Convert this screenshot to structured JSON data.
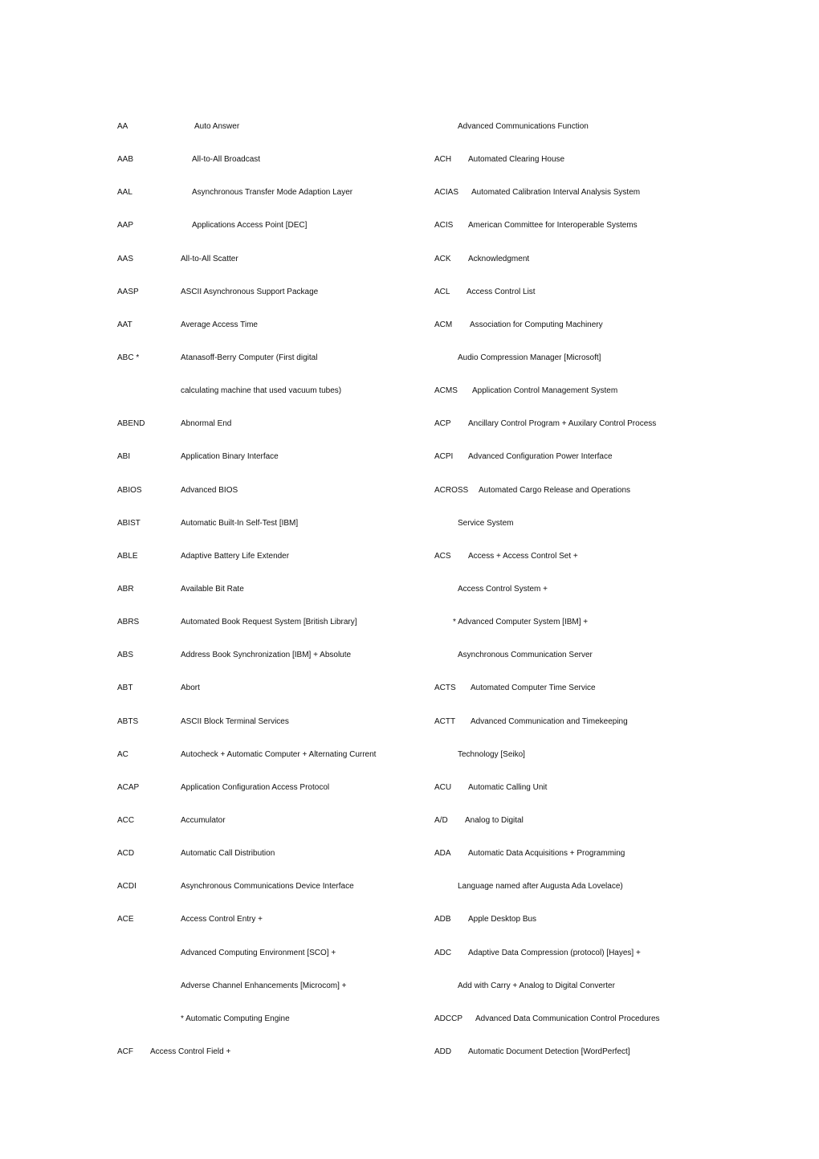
{
  "left_column": [
    {
      "abbr": "AA",
      "def": "Auto Answer"
    },
    {
      "abbr": "AAB",
      "def": "All-to-All Broadcast"
    },
    {
      "abbr": "AAL",
      "def": "Asynchronous Transfer Mode Adaption Layer"
    },
    {
      "abbr": "AAP",
      "def": "Applications Access Point [DEC]"
    },
    {
      "abbr": "AAS",
      "def": "All-to-All Scatter"
    },
    {
      "abbr": "AASP",
      "def": "ASCII Asynchronous Support Package"
    },
    {
      "abbr": "AAT",
      "def": "Average Access Time"
    },
    {
      "abbr": "ABC    *",
      "def": "Atanasoff-Berry Computer  (First digital"
    },
    {
      "abbr": "",
      "def": "calculating machine that used vacuum tubes)"
    },
    {
      "abbr": "ABEND",
      "def": "Abnormal End"
    },
    {
      "abbr": "ABI",
      "def": "Application Binary Interface"
    },
    {
      "abbr": "ABIOS",
      "def": "Advanced BIOS"
    },
    {
      "abbr": "ABIST",
      "def": "Automatic Built-In Self-Test [IBM]"
    },
    {
      "abbr": "ABLE",
      "def": "Adaptive Battery Life Extender"
    },
    {
      "abbr": "ABR",
      "def": "Available Bit Rate"
    },
    {
      "abbr": "ABRS",
      "def": "Automated Book Request System [British Library]"
    },
    {
      "abbr": "ABS",
      "def": "Address Book Synchronization [IBM] + Absolute"
    },
    {
      "abbr": "ABT",
      "def": "Abort"
    },
    {
      "abbr": "ABTS",
      "def": "ASCII Block Terminal Services"
    },
    {
      "abbr": "AC",
      "def": "Autocheck + Automatic Computer + Alternating Current"
    },
    {
      "abbr": "ACAP",
      "def": "Application Configuration Access Protocol"
    },
    {
      "abbr": "ACC",
      "def": "Accumulator"
    },
    {
      "abbr": "ACD",
      "def": "Automatic Call Distribution"
    },
    {
      "abbr": "ACDI",
      "def": "Asynchronous Communications Device Interface"
    },
    {
      "abbr": "ACE",
      "def": "Access Control Entry +"
    },
    {
      "abbr": "",
      "def": "Advanced Computing Environment [SCO] +"
    },
    {
      "abbr": "",
      "def": "Adverse Channel Enhancements [Microcom] +"
    },
    {
      "abbr": "",
      "def": "*  Automatic Computing Engine"
    },
    {
      "abbr": "ACF",
      "def": "Access Control Field +"
    }
  ],
  "right_column": [
    {
      "abbr": "",
      "def": "Advanced Communications Function"
    },
    {
      "abbr": "ACH",
      "def": "Automated Clearing House"
    },
    {
      "abbr": "ACIAS",
      "def": "Automated Calibration Interval Analysis System"
    },
    {
      "abbr": "ACIS",
      "def": "American Committee for Interoperable Systems"
    },
    {
      "abbr": "ACK",
      "def": "Acknowledgment"
    },
    {
      "abbr": "ACL",
      "def": "Access Control List"
    },
    {
      "abbr": "ACM",
      "def": "Association for Computing Machinery"
    },
    {
      "abbr": "",
      "def": "Audio Compression Manager [Microsoft]"
    },
    {
      "abbr": "ACMS",
      "def": "Application Control Management System"
    },
    {
      "abbr": "ACP",
      "def": "Ancillary Control Program + Auxilary Control Process"
    },
    {
      "abbr": "ACPI",
      "def": "Advanced Configuration Power Interface"
    },
    {
      "abbr": "ACROSS",
      "def": "Automated Cargo Release and Operations"
    },
    {
      "abbr": "",
      "def": "Service System"
    },
    {
      "abbr": "ACS",
      "def": "Access + Access Control Set +"
    },
    {
      "abbr": "",
      "def": "Access Control System +"
    },
    {
      "abbr": "",
      "def": "* Advanced Computer System [IBM] +"
    },
    {
      "abbr": "",
      "def": "Asynchronous Communication Server"
    },
    {
      "abbr": "ACTS",
      "def": "Automated Computer Time Service"
    },
    {
      "abbr": "ACTT",
      "def": "Advanced Communication and Timekeeping"
    },
    {
      "abbr": "",
      "def": "Technology [Seiko]"
    },
    {
      "abbr": "ACU",
      "def": "Automatic Calling Unit"
    },
    {
      "abbr": "A/D",
      "def": "Analog to Digital"
    },
    {
      "abbr": "ADA",
      "def": "Automatic Data Acquisitions + Programming"
    },
    {
      "abbr": "",
      "def": "Language named after Augusta Ada Lovelace)"
    },
    {
      "abbr": "ADB",
      "def": "Apple Desktop Bus"
    },
    {
      "abbr": "ADC",
      "def": "Adaptive Data Compression (protocol) [Hayes] +"
    },
    {
      "abbr": "",
      "def": "Add with Carry + Analog to Digital Converter"
    },
    {
      "abbr": "ADCCP",
      "def": "Advanced Data Communication Control Procedures"
    },
    {
      "abbr": "ADD",
      "def": "Automatic Document Detection [WordPerfect]"
    }
  ]
}
